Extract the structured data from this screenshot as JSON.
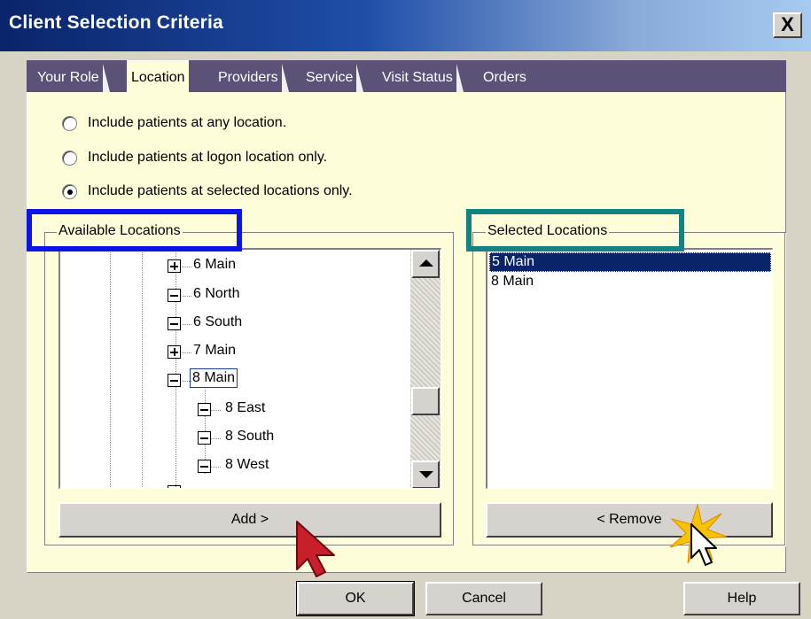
{
  "window": {
    "title": "Client Selection Criteria",
    "close_label": "X"
  },
  "tabs": [
    {
      "label": "Your Role"
    },
    {
      "label": "Location"
    },
    {
      "label": "Providers"
    },
    {
      "label": "Service"
    },
    {
      "label": "Visit Status"
    },
    {
      "label": "Orders"
    }
  ],
  "active_tab": "Location",
  "location_options": {
    "options": [
      {
        "label": "Include patients at any location.",
        "checked": false
      },
      {
        "label": "Include patients at logon location only.",
        "checked": false
      },
      {
        "label": "Include patients at selected locations only.",
        "checked": true
      }
    ]
  },
  "available_locations": {
    "legend": "Available Locations",
    "nodes": [
      {
        "label": "6 Main",
        "state": "collapsed"
      },
      {
        "label": "6 North",
        "state": "expanded"
      },
      {
        "label": "6 South",
        "state": "expanded"
      },
      {
        "label": "7 Main",
        "state": "collapsed"
      },
      {
        "label": "8 Main",
        "state": "expanded",
        "focused": true
      },
      {
        "label": "8 East",
        "state": "expanded"
      },
      {
        "label": "8 South",
        "state": "expanded"
      },
      {
        "label": "8 West",
        "state": "expanded"
      }
    ],
    "add_button": "Add >"
  },
  "selected_locations": {
    "legend": "Selected Locations",
    "items": [
      {
        "label": "5 Main",
        "selected": true
      },
      {
        "label": "8 Main",
        "selected": false
      }
    ],
    "remove_button": "< Remove"
  },
  "footer": {
    "ok": "OK",
    "cancel": "Cancel",
    "help": "Help"
  },
  "annotations": {
    "available_highlight_color": "#0A14E6",
    "selected_highlight_color": "#138282",
    "pointer_color": "#C8202A",
    "sparkle_color": "#F5C400"
  },
  "colors": {
    "panel": "#FEFDD9",
    "dialog": "#D8D4C5",
    "tabstrip": "#5C5278",
    "selection": "#0A246A"
  }
}
